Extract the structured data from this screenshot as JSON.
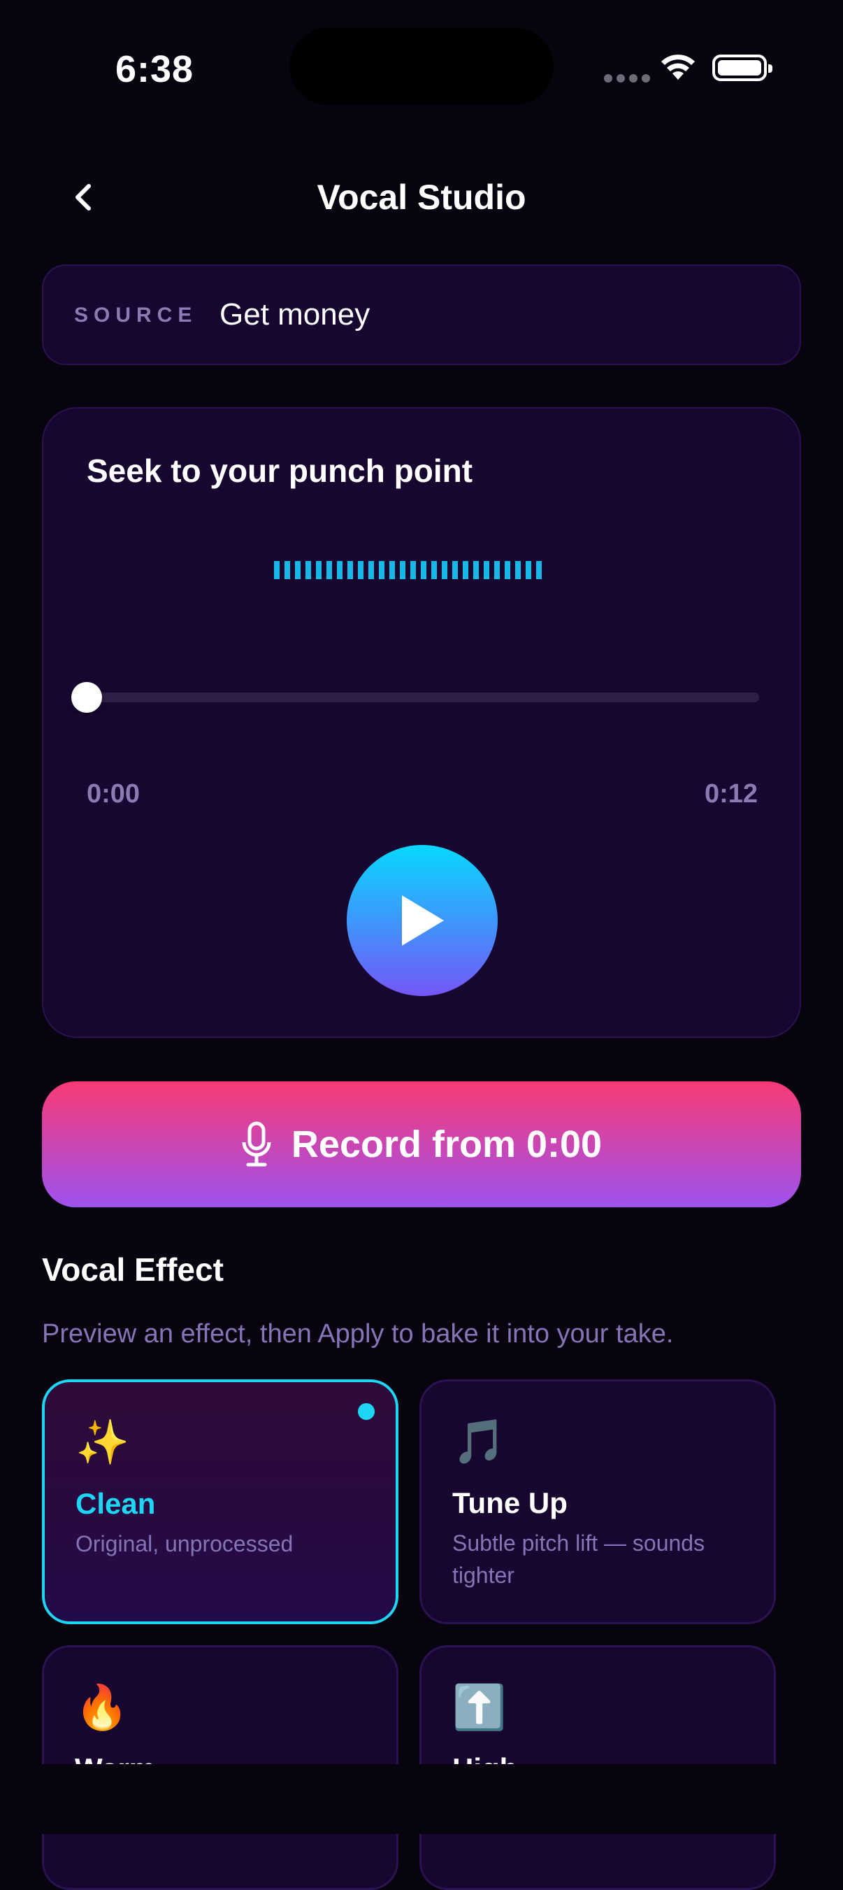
{
  "status_bar": {
    "time": "6:38"
  },
  "header": {
    "title": "Vocal Studio"
  },
  "source": {
    "label": "SOURCE",
    "value": "Get money"
  },
  "player": {
    "title": "Seek to your punch point",
    "waveform_bar_count": 26,
    "position_fraction": 0,
    "current_time": "0:00",
    "duration": "0:12"
  },
  "record": {
    "label": "Record from 0:00"
  },
  "vocal_effect": {
    "title": "Vocal Effect",
    "subtitle": "Preview an effect, then Apply to bake it into your take.",
    "effects": [
      {
        "emoji": "✨",
        "name": "Clean",
        "description": "Original, unprocessed",
        "selected": true
      },
      {
        "emoji": "🎵",
        "name": "Tune Up",
        "description": "Subtle pitch lift — sounds tighter",
        "selected": false
      },
      {
        "emoji": "🔥",
        "name": "Warm",
        "description": "",
        "selected": false
      },
      {
        "emoji": "⬆️",
        "name": "High",
        "description": "",
        "selected": false
      }
    ]
  },
  "colors": {
    "background": "#07030f",
    "card": "#170630",
    "accent": "#1ed6f4",
    "muted_text": "#8675b6",
    "record_gradient_top": "#f83a75",
    "record_gradient_bottom": "#9d52ef"
  }
}
